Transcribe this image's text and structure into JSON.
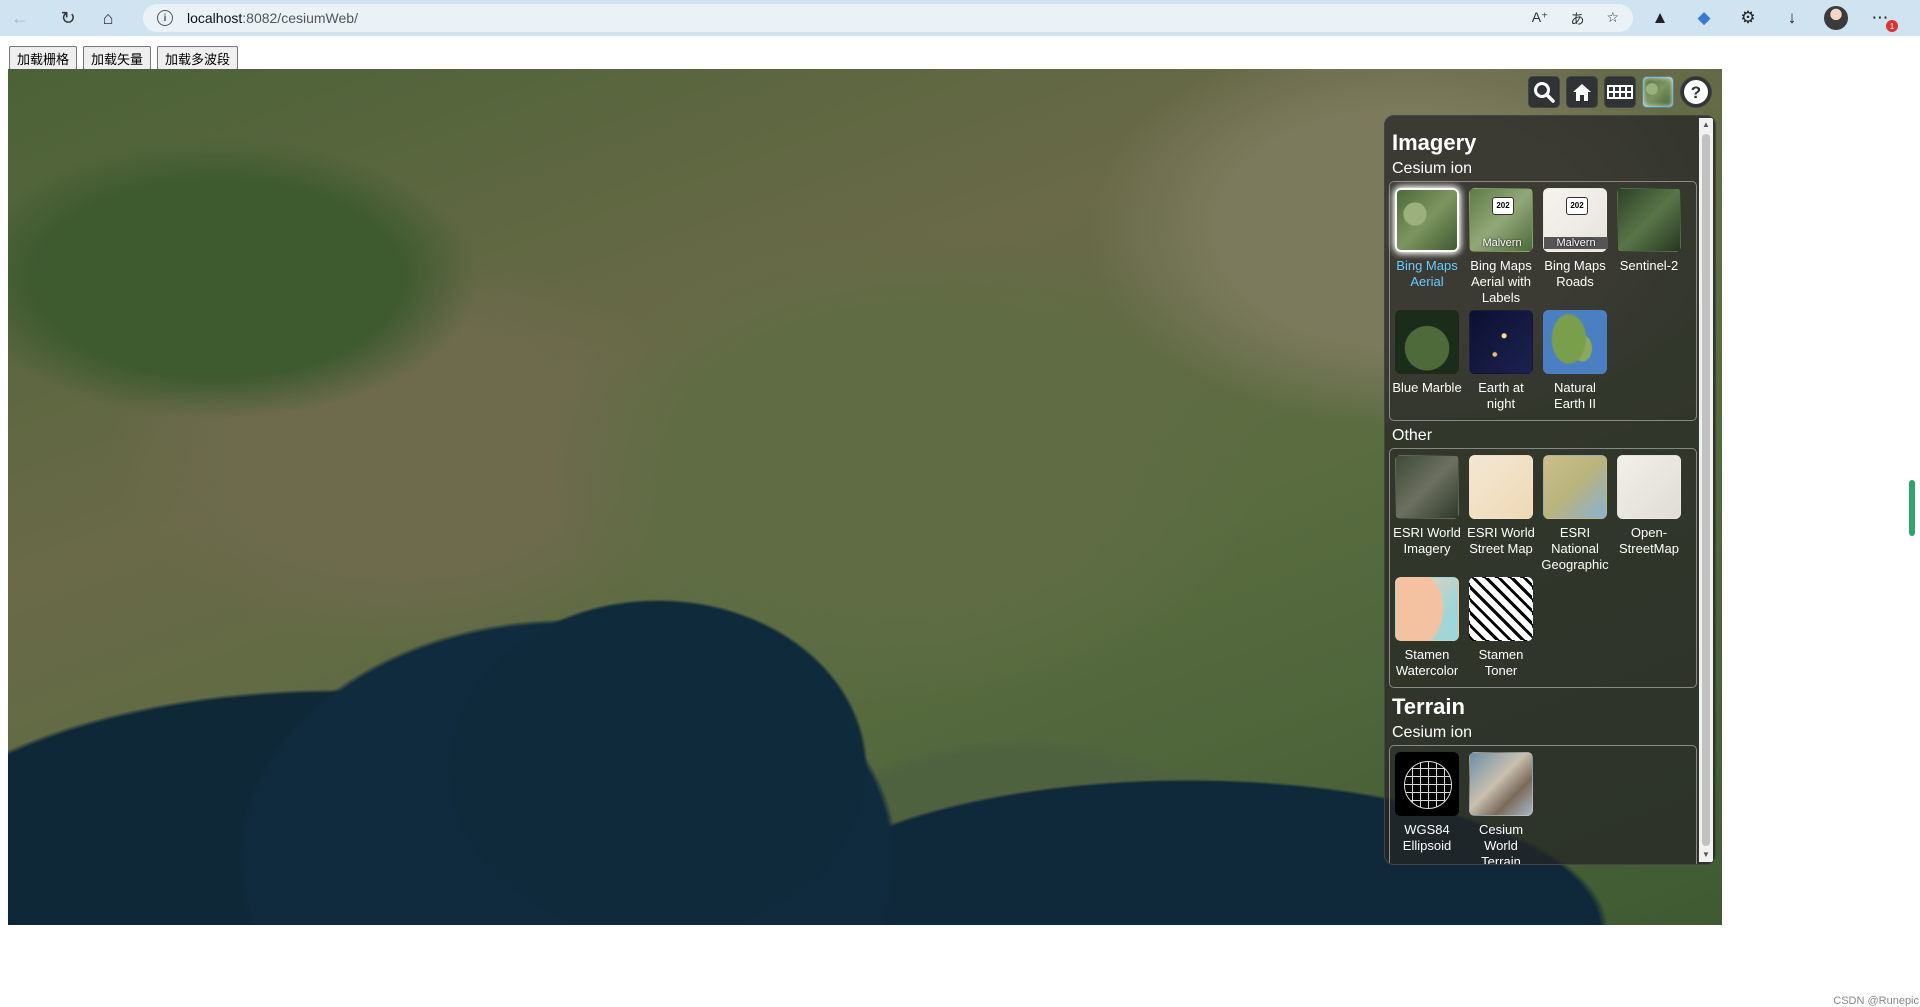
{
  "browser": {
    "url_host": "localhost",
    "url_rest": ":8082/cesiumWeb/",
    "notification_count": "1"
  },
  "page_buttons": [
    "加载栅格",
    "加载矢量",
    "加载多波段"
  ],
  "layer_picker": {
    "imagery_title": "Imagery",
    "imagery_categories": [
      {
        "title": "Cesium ion",
        "items": [
          {
            "label": "Bing Maps Aerial",
            "selected": true
          },
          {
            "label": "Bing Maps Aerial with Labels",
            "sign": "202",
            "place": "Malvern"
          },
          {
            "label": "Bing Maps Roads",
            "sign": "202",
            "place": "Malvern"
          },
          {
            "label": "Sentinel-2"
          },
          {
            "label": "Blue Marble"
          },
          {
            "label": "Earth at night"
          },
          {
            "label": "Natural Earth II"
          }
        ]
      },
      {
        "title": "Other",
        "items": [
          {
            "label": "ESRI World Imagery"
          },
          {
            "label": "ESRI World Street Map"
          },
          {
            "label": "ESRI National Geographic"
          },
          {
            "label": "Open-StreetMap"
          },
          {
            "label": "Stamen Watercolor"
          },
          {
            "label": "Stamen Toner"
          }
        ]
      }
    ],
    "terrain_title": "Terrain",
    "terrain_categories": [
      {
        "title": "Cesium ion",
        "items": [
          {
            "label": "WGS84 Ellipsoid"
          },
          {
            "label": "Cesium World Terrain"
          }
        ]
      }
    ]
  },
  "watermark": "CSDN @Runepic"
}
